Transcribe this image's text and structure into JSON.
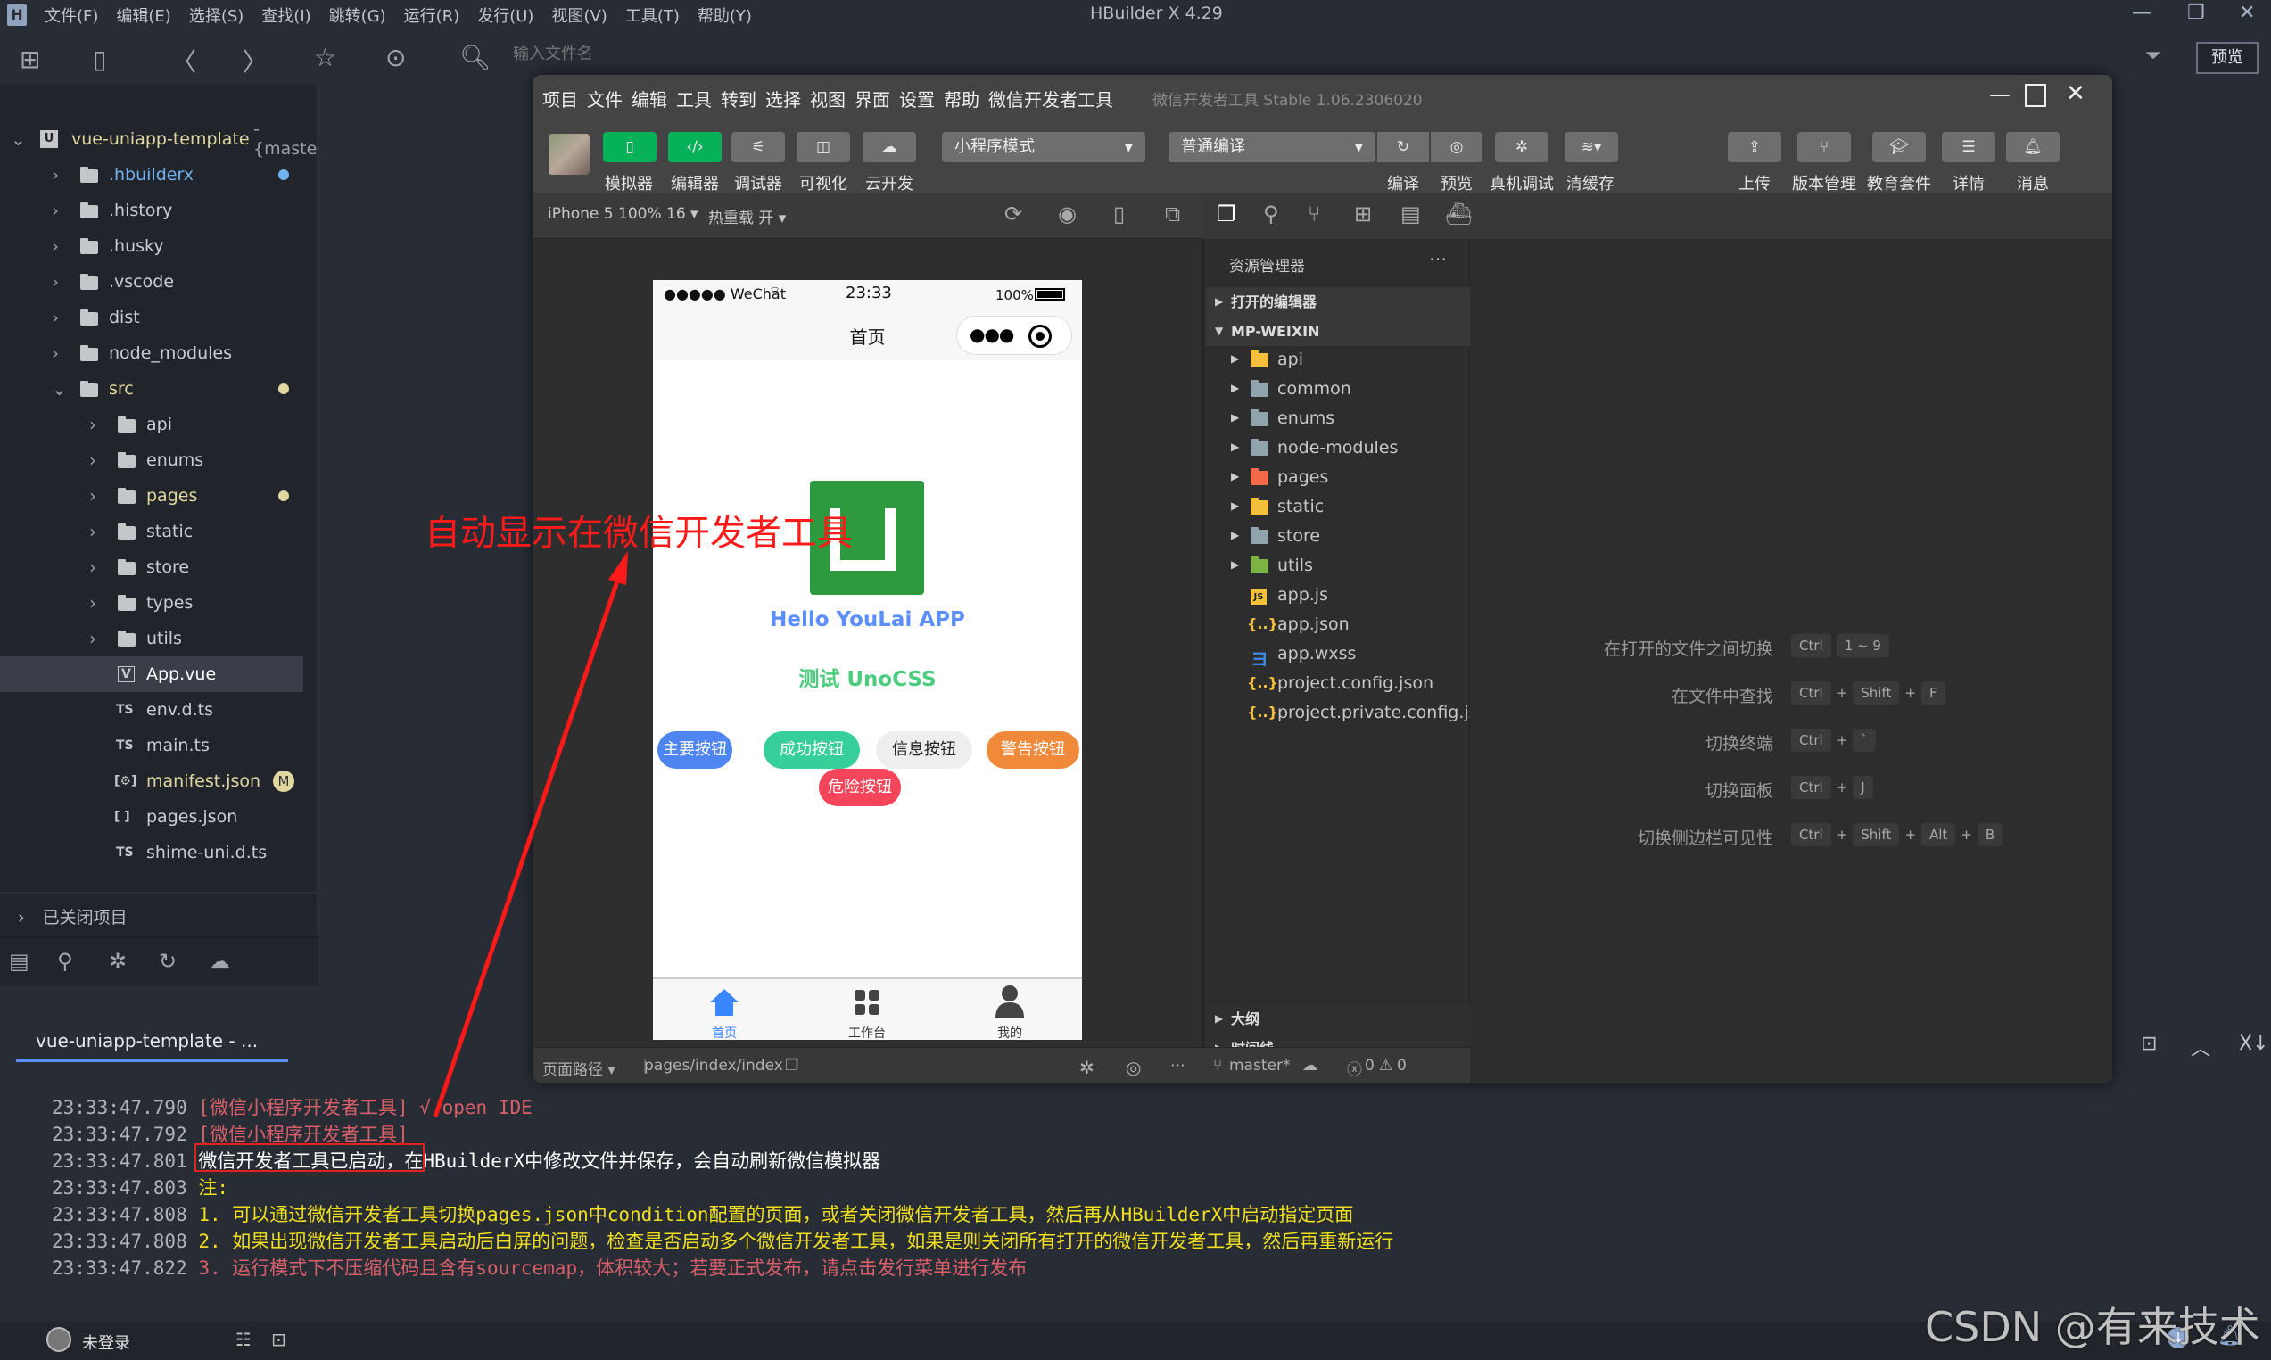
{
  "hbuilder": {
    "title": "HBuilder X 4.29",
    "menu": [
      "文件(F)",
      "编辑(E)",
      "选择(S)",
      "查找(I)",
      "跳转(G)",
      "运行(R)",
      "发行(U)",
      "视图(V)",
      "工具(T)",
      "帮助(Y)"
    ],
    "search_placeholder": "输入文件名",
    "preview_button": "预览",
    "project_name": "vue-uniapp-template",
    "project_branch": "- {maste",
    "tree": [
      {
        "name": ".hbuilderx",
        "type": "folder",
        "level": 1,
        "status": "blue"
      },
      {
        "name": ".history",
        "type": "folder",
        "level": 1
      },
      {
        "name": ".husky",
        "type": "folder",
        "level": 1
      },
      {
        "name": ".vscode",
        "type": "folder",
        "level": 1
      },
      {
        "name": "dist",
        "type": "folder",
        "level": 1
      },
      {
        "name": "node_modules",
        "type": "folder",
        "level": 1
      },
      {
        "name": "src",
        "type": "folder-open",
        "level": 1,
        "status": "yellow"
      },
      {
        "name": "api",
        "type": "folder",
        "level": 2
      },
      {
        "name": "enums",
        "type": "folder",
        "level": 2
      },
      {
        "name": "pages",
        "type": "folder",
        "level": 2,
        "status": "yellow"
      },
      {
        "name": "static",
        "type": "folder",
        "level": 2
      },
      {
        "name": "store",
        "type": "folder",
        "level": 2
      },
      {
        "name": "types",
        "type": "folder",
        "level": 2
      },
      {
        "name": "utils",
        "type": "folder",
        "level": 2
      },
      {
        "name": "App.vue",
        "type": "vue",
        "level": 2,
        "selected": true
      },
      {
        "name": "env.d.ts",
        "type": "ts",
        "level": 2
      },
      {
        "name": "main.ts",
        "type": "ts",
        "level": 2
      },
      {
        "name": "manifest.json",
        "type": "manifest",
        "level": 2,
        "badge": "M"
      },
      {
        "name": "pages.json",
        "type": "json",
        "level": 2
      },
      {
        "name": "shime-uni.d.ts",
        "type": "ts",
        "level": 2
      }
    ],
    "closed_projects": "已关闭项目",
    "console_tab": "vue-uniapp-template - ...",
    "console_lines": [
      {
        "ts": "23:33:47.790",
        "parts": [
          {
            "text": "[微信小程序开发者工具] √ open IDE",
            "color": "#d9606a"
          }
        ]
      },
      {
        "ts": "23:33:47.792",
        "parts": [
          {
            "text": "[微信小程序开发者工具]",
            "color": "#d9606a"
          }
        ]
      },
      {
        "ts": "23:33:47.801",
        "parts": [
          {
            "text": "微信开发者工具已启动",
            "color": "#ffffff"
          },
          {
            "text": "，在HBuilderX中修改文件并保存，会自动刷新微信模拟器",
            "color": "#ffffff"
          }
        ]
      },
      {
        "ts": "23:33:47.803",
        "parts": [
          {
            "text": "注:",
            "color": "#f0e020"
          }
        ]
      },
      {
        "ts": "23:33:47.808",
        "parts": [
          {
            "text": "1. 可以通过微信开发者工具切换pages.json中condition配置的页面，或者关闭微信开发者工具，然后再从HBuilderX中启动指定页面",
            "color": "#f0e020"
          }
        ]
      },
      {
        "ts": "23:33:47.808",
        "parts": [
          {
            "text": "2. 如果出现微信开发者工具启动后白屏的问题，检查是否启动多个微信开发者工具，如果是则关闭所有打开的微信开发者工具，然后再重新运行",
            "color": "#f0e020"
          }
        ]
      },
      {
        "ts": "23:33:47.822",
        "parts": [
          {
            "text": "3. 运行模式下不压缩代码且含有sourcemap，体积较大；若要正式发布，请点击发行菜单进行发布",
            "color": "#d9606a"
          }
        ]
      }
    ],
    "login_status": "未登录"
  },
  "wechat_devtools": {
    "menu": [
      "项目",
      "文件",
      "编辑",
      "工具",
      "转到",
      "选择",
      "视图",
      "界面",
      "设置",
      "帮助",
      "微信开发者工具"
    ],
    "version": "微信开发者工具 Stable 1.06.2306020",
    "left_tools": [
      "模拟器",
      "编辑器",
      "调试器",
      "可视化",
      "云开发"
    ],
    "mode_select": "小程序模式",
    "compile_select": "普通编译",
    "mid_tools": [
      "编译",
      "预览",
      "真机调试",
      "清缓存"
    ],
    "right_tools": [
      "上传",
      "版本管理",
      "教育套件",
      "详情",
      "消息"
    ],
    "device": "iPhone 5 100% 16",
    "hot_reload": "热重载 开",
    "page_path_label": "页面路径",
    "page_path": "pages/index/index",
    "explorer_title": "资源管理器",
    "open_editors": "打开的编辑器",
    "project_root": "MP-WEIXIN",
    "files": [
      {
        "name": "api",
        "type": "folder",
        "color": "#f5c13d"
      },
      {
        "name": "common",
        "type": "folder",
        "color": "#90a4ae"
      },
      {
        "name": "enums",
        "type": "folder",
        "color": "#90a4ae"
      },
      {
        "name": "node-modules",
        "type": "folder",
        "color": "#90a4ae"
      },
      {
        "name": "pages",
        "type": "folder",
        "color": "#f4694a"
      },
      {
        "name": "static",
        "type": "folder",
        "color": "#f5c13d"
      },
      {
        "name": "store",
        "type": "folder",
        "color": "#90a4ae"
      },
      {
        "name": "utils",
        "type": "folder",
        "color": "#7cb342"
      },
      {
        "name": "app.js",
        "type": "js"
      },
      {
        "name": "app.json",
        "type": "json"
      },
      {
        "name": "app.wxss",
        "type": "css"
      },
      {
        "name": "project.config.json",
        "type": "json"
      },
      {
        "name": "project.private.config.js...",
        "type": "json"
      }
    ],
    "outline": "大纲",
    "timeline": "时间线",
    "branch": "master*",
    "errors": "0",
    "warnings": "0",
    "shortcuts": [
      {
        "label": "在打开的文件之间切换",
        "keys": [
          "Ctrl",
          "1 ~ 9"
        ],
        "joined": false
      },
      {
        "label": "在文件中查找",
        "keys": [
          "Ctrl",
          "Shift",
          "F"
        ],
        "joined": true
      },
      {
        "label": "切换终端",
        "keys": [
          "Ctrl",
          "`"
        ],
        "joined": true
      },
      {
        "label": "切换面板",
        "keys": [
          "Ctrl",
          "J"
        ],
        "joined": true
      },
      {
        "label": "切换侧边栏可见性",
        "keys": [
          "Ctrl",
          "Shift",
          "Alt",
          "B"
        ],
        "joined": true
      }
    ]
  },
  "phone": {
    "carrier": "●●●●● WeChat",
    "time": "23:33",
    "battery": "100%",
    "nav_title": "首页",
    "hello": "Hello YouLai APP",
    "unocss": "测试 UnoCSS",
    "buttons": [
      {
        "label": "主要按钮",
        "color": "#4f85f0",
        "text": "#ffffff"
      },
      {
        "label": "成功按钮",
        "color": "#36cf99",
        "text": "#ffffff"
      },
      {
        "label": "信息按钮",
        "color": "#eeeeee",
        "text": "#222222"
      },
      {
        "label": "警告按钮",
        "color": "#f08a3a",
        "text": "#ffffff"
      },
      {
        "label": "危险按钮",
        "color": "#f5455a",
        "text": "#ffffff"
      }
    ],
    "tabs": [
      {
        "label": "首页",
        "active": true
      },
      {
        "label": "工作台",
        "active": false
      },
      {
        "label": "我的",
        "active": false
      }
    ],
    "active_color": "#3a86ff"
  },
  "annotation": "自动显示在微信开发者工具",
  "watermark": "CSDN @有来技术"
}
